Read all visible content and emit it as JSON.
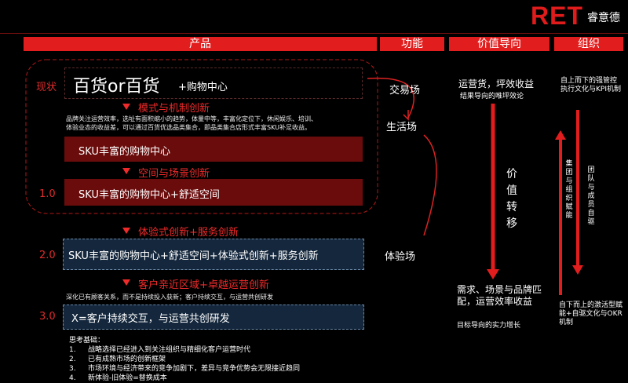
{
  "brand": {
    "logo": "RET",
    "logo_cn": "睿意德"
  },
  "headers": {
    "product": "产品",
    "function": "功能",
    "value": "价值导向",
    "org": "组织"
  },
  "stages": {
    "current": "现状",
    "s1": "1.0",
    "s2": "2.0",
    "s3": "3.0"
  },
  "rows": {
    "r0_big": "百货or百货",
    "r0_small": "+购物中心",
    "r1": "SKU丰富的购物中心",
    "r2": "SKU丰富的购物中心+舒适空间",
    "r3": "SKU丰富的购物中心+舒适空间+体验式创新+服务创新",
    "r4": "X=客户持续交互，与运营共创研发"
  },
  "steps": {
    "a": "模式与机制创新",
    "b": "空间与场景创新",
    "c": "体验式创新+服务创新",
    "d": "客户亲近区域+卓越运营创新"
  },
  "notes": {
    "n1_l1": "品牌关注运营效率，选址有面积缩小的趋势，体量中等，丰富化定位下，休闲娱乐、培训、",
    "n1_l2": "体验业态的收益差，可以通过百货优选品类集合，即品类集合店形式丰富SKU补足收益。",
    "n2": "深化已有顾客关系，而不是持续投入获新；客户持续交互，与运营共创研发"
  },
  "functions": {
    "f1": "交易场",
    "f2": "生活场",
    "f3": "体验场"
  },
  "value": {
    "top": "运营货，坪效收益",
    "top_sub": "结果导向的唯坪效论",
    "middle": [
      "价",
      "值",
      "转",
      "移"
    ],
    "bottom": "需求、场景与品牌匹配，运营效率收益",
    "bottom_sub": "目标导向的实力增长"
  },
  "org": {
    "top": "自上而下的强管控执行文化与KPI机制",
    "col1": [
      "集",
      "团",
      "与",
      "组",
      "织",
      "赋",
      "能"
    ],
    "col2": [
      "团",
      "队",
      "与",
      "成",
      "员",
      "自",
      "驱"
    ],
    "bottom": "自下而上的激活型赋能+自驱文化与OKR机制"
  },
  "thinking": {
    "title": "思考基础：",
    "items": [
      {
        "n": "1.",
        "t": "战略选择已经进入到关注组织与精细化客户运营时代"
      },
      {
        "n": "2.",
        "t": "已有成熟市场的创新框架"
      },
      {
        "n": "3.",
        "t": "市场环境与经济带来的竞争加剧下，差异与竞争优势会无限接近趋同"
      },
      {
        "n": "4.",
        "t": "新体验-旧体验=替换成本"
      }
    ]
  }
}
